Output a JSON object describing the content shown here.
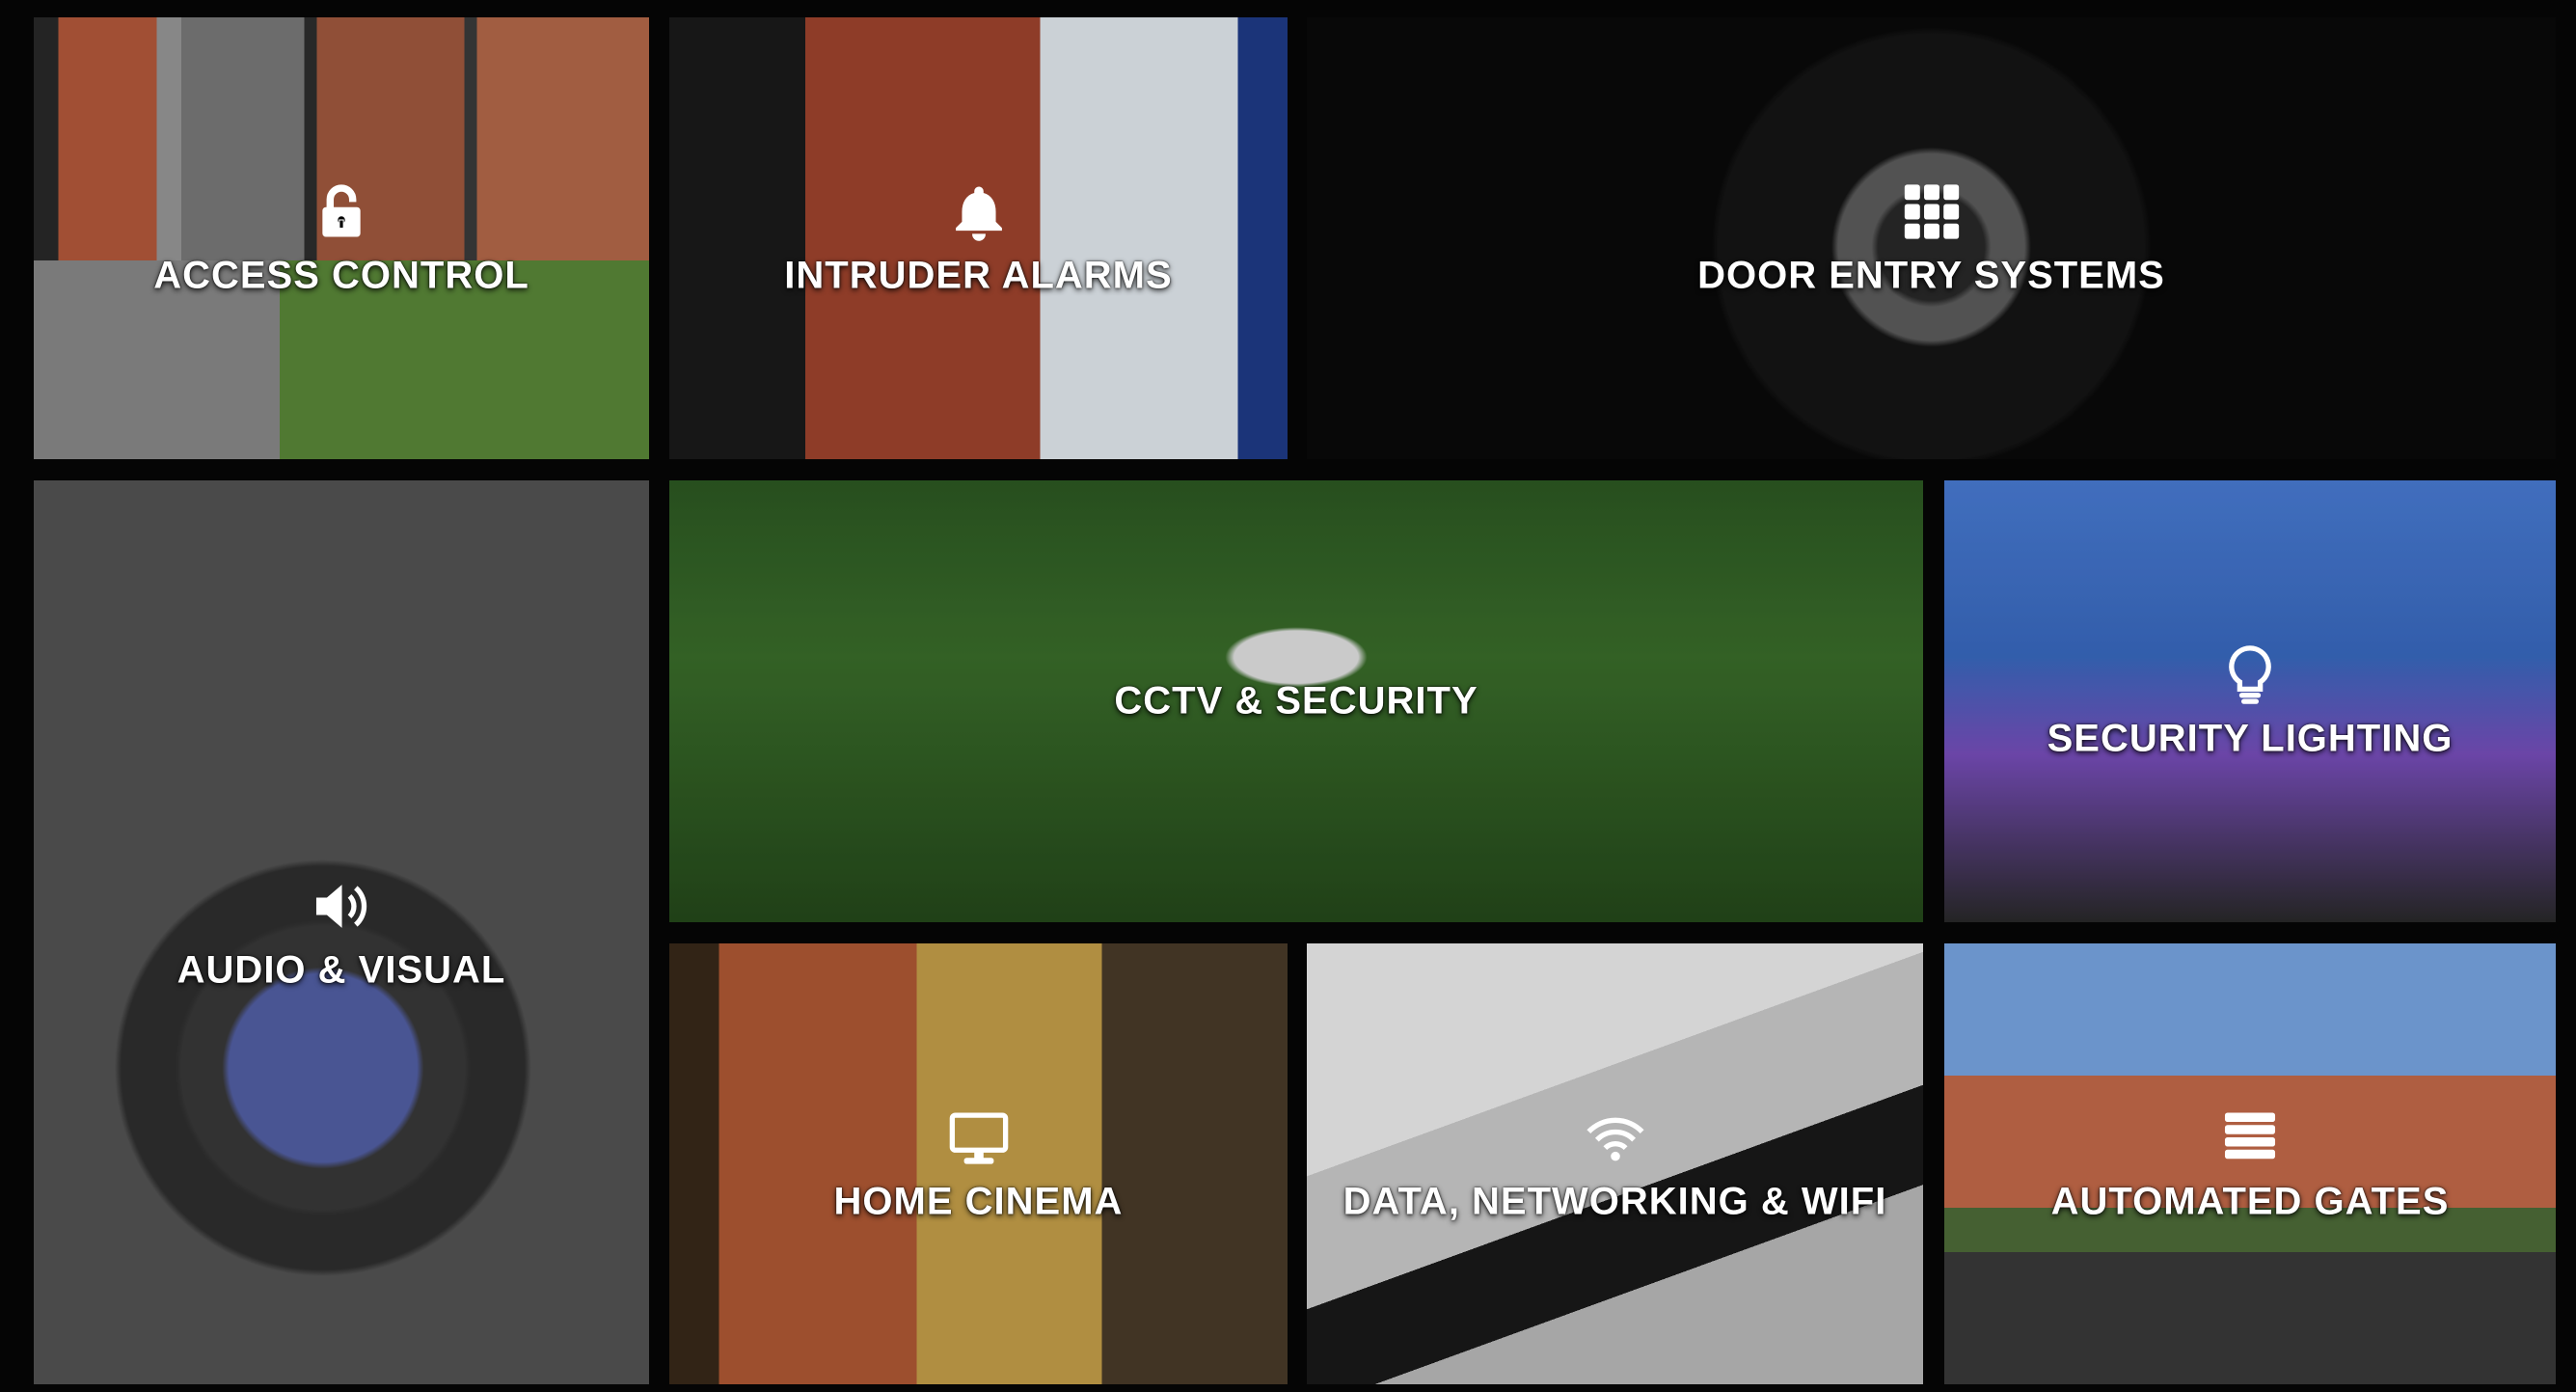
{
  "tiles": [
    {
      "id": "access",
      "label": "ACCESS CONTROL",
      "icon": "unlock-icon"
    },
    {
      "id": "intruder",
      "label": "INTRUDER ALARMS",
      "icon": "bell-icon"
    },
    {
      "id": "door",
      "label": "DOOR ENTRY SYSTEMS",
      "icon": "keypad-grid-icon"
    },
    {
      "id": "audio",
      "label": "AUDIO & VISUAL",
      "icon": "speaker-icon"
    },
    {
      "id": "cctv",
      "label": "CCTV & SECURITY",
      "icon": "none"
    },
    {
      "id": "lighting",
      "label": "SECURITY LIGHTING",
      "icon": "lightbulb-icon"
    },
    {
      "id": "cinema",
      "label": "HOME CINEMA",
      "icon": "monitor-icon"
    },
    {
      "id": "data",
      "label": "DATA, NETWORKING & WIFI",
      "icon": "wifi-icon"
    },
    {
      "id": "gates",
      "label": "AUTOMATED GATES",
      "icon": "gate-bars-icon"
    }
  ]
}
